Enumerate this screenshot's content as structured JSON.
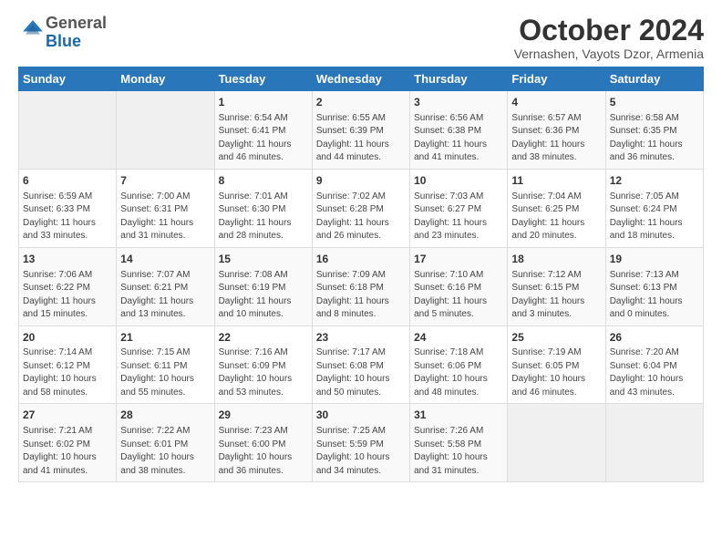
{
  "logo": {
    "general": "General",
    "blue": "Blue"
  },
  "title": "October 2024",
  "location": "Vernashen, Vayots Dzor, Armenia",
  "days_of_week": [
    "Sunday",
    "Monday",
    "Tuesday",
    "Wednesday",
    "Thursday",
    "Friday",
    "Saturday"
  ],
  "weeks": [
    [
      {
        "day": "",
        "sunrise": "",
        "sunset": "",
        "daylight": ""
      },
      {
        "day": "",
        "sunrise": "",
        "sunset": "",
        "daylight": ""
      },
      {
        "day": "1",
        "sunrise": "Sunrise: 6:54 AM",
        "sunset": "Sunset: 6:41 PM",
        "daylight": "Daylight: 11 hours and 46 minutes."
      },
      {
        "day": "2",
        "sunrise": "Sunrise: 6:55 AM",
        "sunset": "Sunset: 6:39 PM",
        "daylight": "Daylight: 11 hours and 44 minutes."
      },
      {
        "day": "3",
        "sunrise": "Sunrise: 6:56 AM",
        "sunset": "Sunset: 6:38 PM",
        "daylight": "Daylight: 11 hours and 41 minutes."
      },
      {
        "day": "4",
        "sunrise": "Sunrise: 6:57 AM",
        "sunset": "Sunset: 6:36 PM",
        "daylight": "Daylight: 11 hours and 38 minutes."
      },
      {
        "day": "5",
        "sunrise": "Sunrise: 6:58 AM",
        "sunset": "Sunset: 6:35 PM",
        "daylight": "Daylight: 11 hours and 36 minutes."
      }
    ],
    [
      {
        "day": "6",
        "sunrise": "Sunrise: 6:59 AM",
        "sunset": "Sunset: 6:33 PM",
        "daylight": "Daylight: 11 hours and 33 minutes."
      },
      {
        "day": "7",
        "sunrise": "Sunrise: 7:00 AM",
        "sunset": "Sunset: 6:31 PM",
        "daylight": "Daylight: 11 hours and 31 minutes."
      },
      {
        "day": "8",
        "sunrise": "Sunrise: 7:01 AM",
        "sunset": "Sunset: 6:30 PM",
        "daylight": "Daylight: 11 hours and 28 minutes."
      },
      {
        "day": "9",
        "sunrise": "Sunrise: 7:02 AM",
        "sunset": "Sunset: 6:28 PM",
        "daylight": "Daylight: 11 hours and 26 minutes."
      },
      {
        "day": "10",
        "sunrise": "Sunrise: 7:03 AM",
        "sunset": "Sunset: 6:27 PM",
        "daylight": "Daylight: 11 hours and 23 minutes."
      },
      {
        "day": "11",
        "sunrise": "Sunrise: 7:04 AM",
        "sunset": "Sunset: 6:25 PM",
        "daylight": "Daylight: 11 hours and 20 minutes."
      },
      {
        "day": "12",
        "sunrise": "Sunrise: 7:05 AM",
        "sunset": "Sunset: 6:24 PM",
        "daylight": "Daylight: 11 hours and 18 minutes."
      }
    ],
    [
      {
        "day": "13",
        "sunrise": "Sunrise: 7:06 AM",
        "sunset": "Sunset: 6:22 PM",
        "daylight": "Daylight: 11 hours and 15 minutes."
      },
      {
        "day": "14",
        "sunrise": "Sunrise: 7:07 AM",
        "sunset": "Sunset: 6:21 PM",
        "daylight": "Daylight: 11 hours and 13 minutes."
      },
      {
        "day": "15",
        "sunrise": "Sunrise: 7:08 AM",
        "sunset": "Sunset: 6:19 PM",
        "daylight": "Daylight: 11 hours and 10 minutes."
      },
      {
        "day": "16",
        "sunrise": "Sunrise: 7:09 AM",
        "sunset": "Sunset: 6:18 PM",
        "daylight": "Daylight: 11 hours and 8 minutes."
      },
      {
        "day": "17",
        "sunrise": "Sunrise: 7:10 AM",
        "sunset": "Sunset: 6:16 PM",
        "daylight": "Daylight: 11 hours and 5 minutes."
      },
      {
        "day": "18",
        "sunrise": "Sunrise: 7:12 AM",
        "sunset": "Sunset: 6:15 PM",
        "daylight": "Daylight: 11 hours and 3 minutes."
      },
      {
        "day": "19",
        "sunrise": "Sunrise: 7:13 AM",
        "sunset": "Sunset: 6:13 PM",
        "daylight": "Daylight: 11 hours and 0 minutes."
      }
    ],
    [
      {
        "day": "20",
        "sunrise": "Sunrise: 7:14 AM",
        "sunset": "Sunset: 6:12 PM",
        "daylight": "Daylight: 10 hours and 58 minutes."
      },
      {
        "day": "21",
        "sunrise": "Sunrise: 7:15 AM",
        "sunset": "Sunset: 6:11 PM",
        "daylight": "Daylight: 10 hours and 55 minutes."
      },
      {
        "day": "22",
        "sunrise": "Sunrise: 7:16 AM",
        "sunset": "Sunset: 6:09 PM",
        "daylight": "Daylight: 10 hours and 53 minutes."
      },
      {
        "day": "23",
        "sunrise": "Sunrise: 7:17 AM",
        "sunset": "Sunset: 6:08 PM",
        "daylight": "Daylight: 10 hours and 50 minutes."
      },
      {
        "day": "24",
        "sunrise": "Sunrise: 7:18 AM",
        "sunset": "Sunset: 6:06 PM",
        "daylight": "Daylight: 10 hours and 48 minutes."
      },
      {
        "day": "25",
        "sunrise": "Sunrise: 7:19 AM",
        "sunset": "Sunset: 6:05 PM",
        "daylight": "Daylight: 10 hours and 46 minutes."
      },
      {
        "day": "26",
        "sunrise": "Sunrise: 7:20 AM",
        "sunset": "Sunset: 6:04 PM",
        "daylight": "Daylight: 10 hours and 43 minutes."
      }
    ],
    [
      {
        "day": "27",
        "sunrise": "Sunrise: 7:21 AM",
        "sunset": "Sunset: 6:02 PM",
        "daylight": "Daylight: 10 hours and 41 minutes."
      },
      {
        "day": "28",
        "sunrise": "Sunrise: 7:22 AM",
        "sunset": "Sunset: 6:01 PM",
        "daylight": "Daylight: 10 hours and 38 minutes."
      },
      {
        "day": "29",
        "sunrise": "Sunrise: 7:23 AM",
        "sunset": "Sunset: 6:00 PM",
        "daylight": "Daylight: 10 hours and 36 minutes."
      },
      {
        "day": "30",
        "sunrise": "Sunrise: 7:25 AM",
        "sunset": "Sunset: 5:59 PM",
        "daylight": "Daylight: 10 hours and 34 minutes."
      },
      {
        "day": "31",
        "sunrise": "Sunrise: 7:26 AM",
        "sunset": "Sunset: 5:58 PM",
        "daylight": "Daylight: 10 hours and 31 minutes."
      },
      {
        "day": "",
        "sunrise": "",
        "sunset": "",
        "daylight": ""
      },
      {
        "day": "",
        "sunrise": "",
        "sunset": "",
        "daylight": ""
      }
    ]
  ]
}
